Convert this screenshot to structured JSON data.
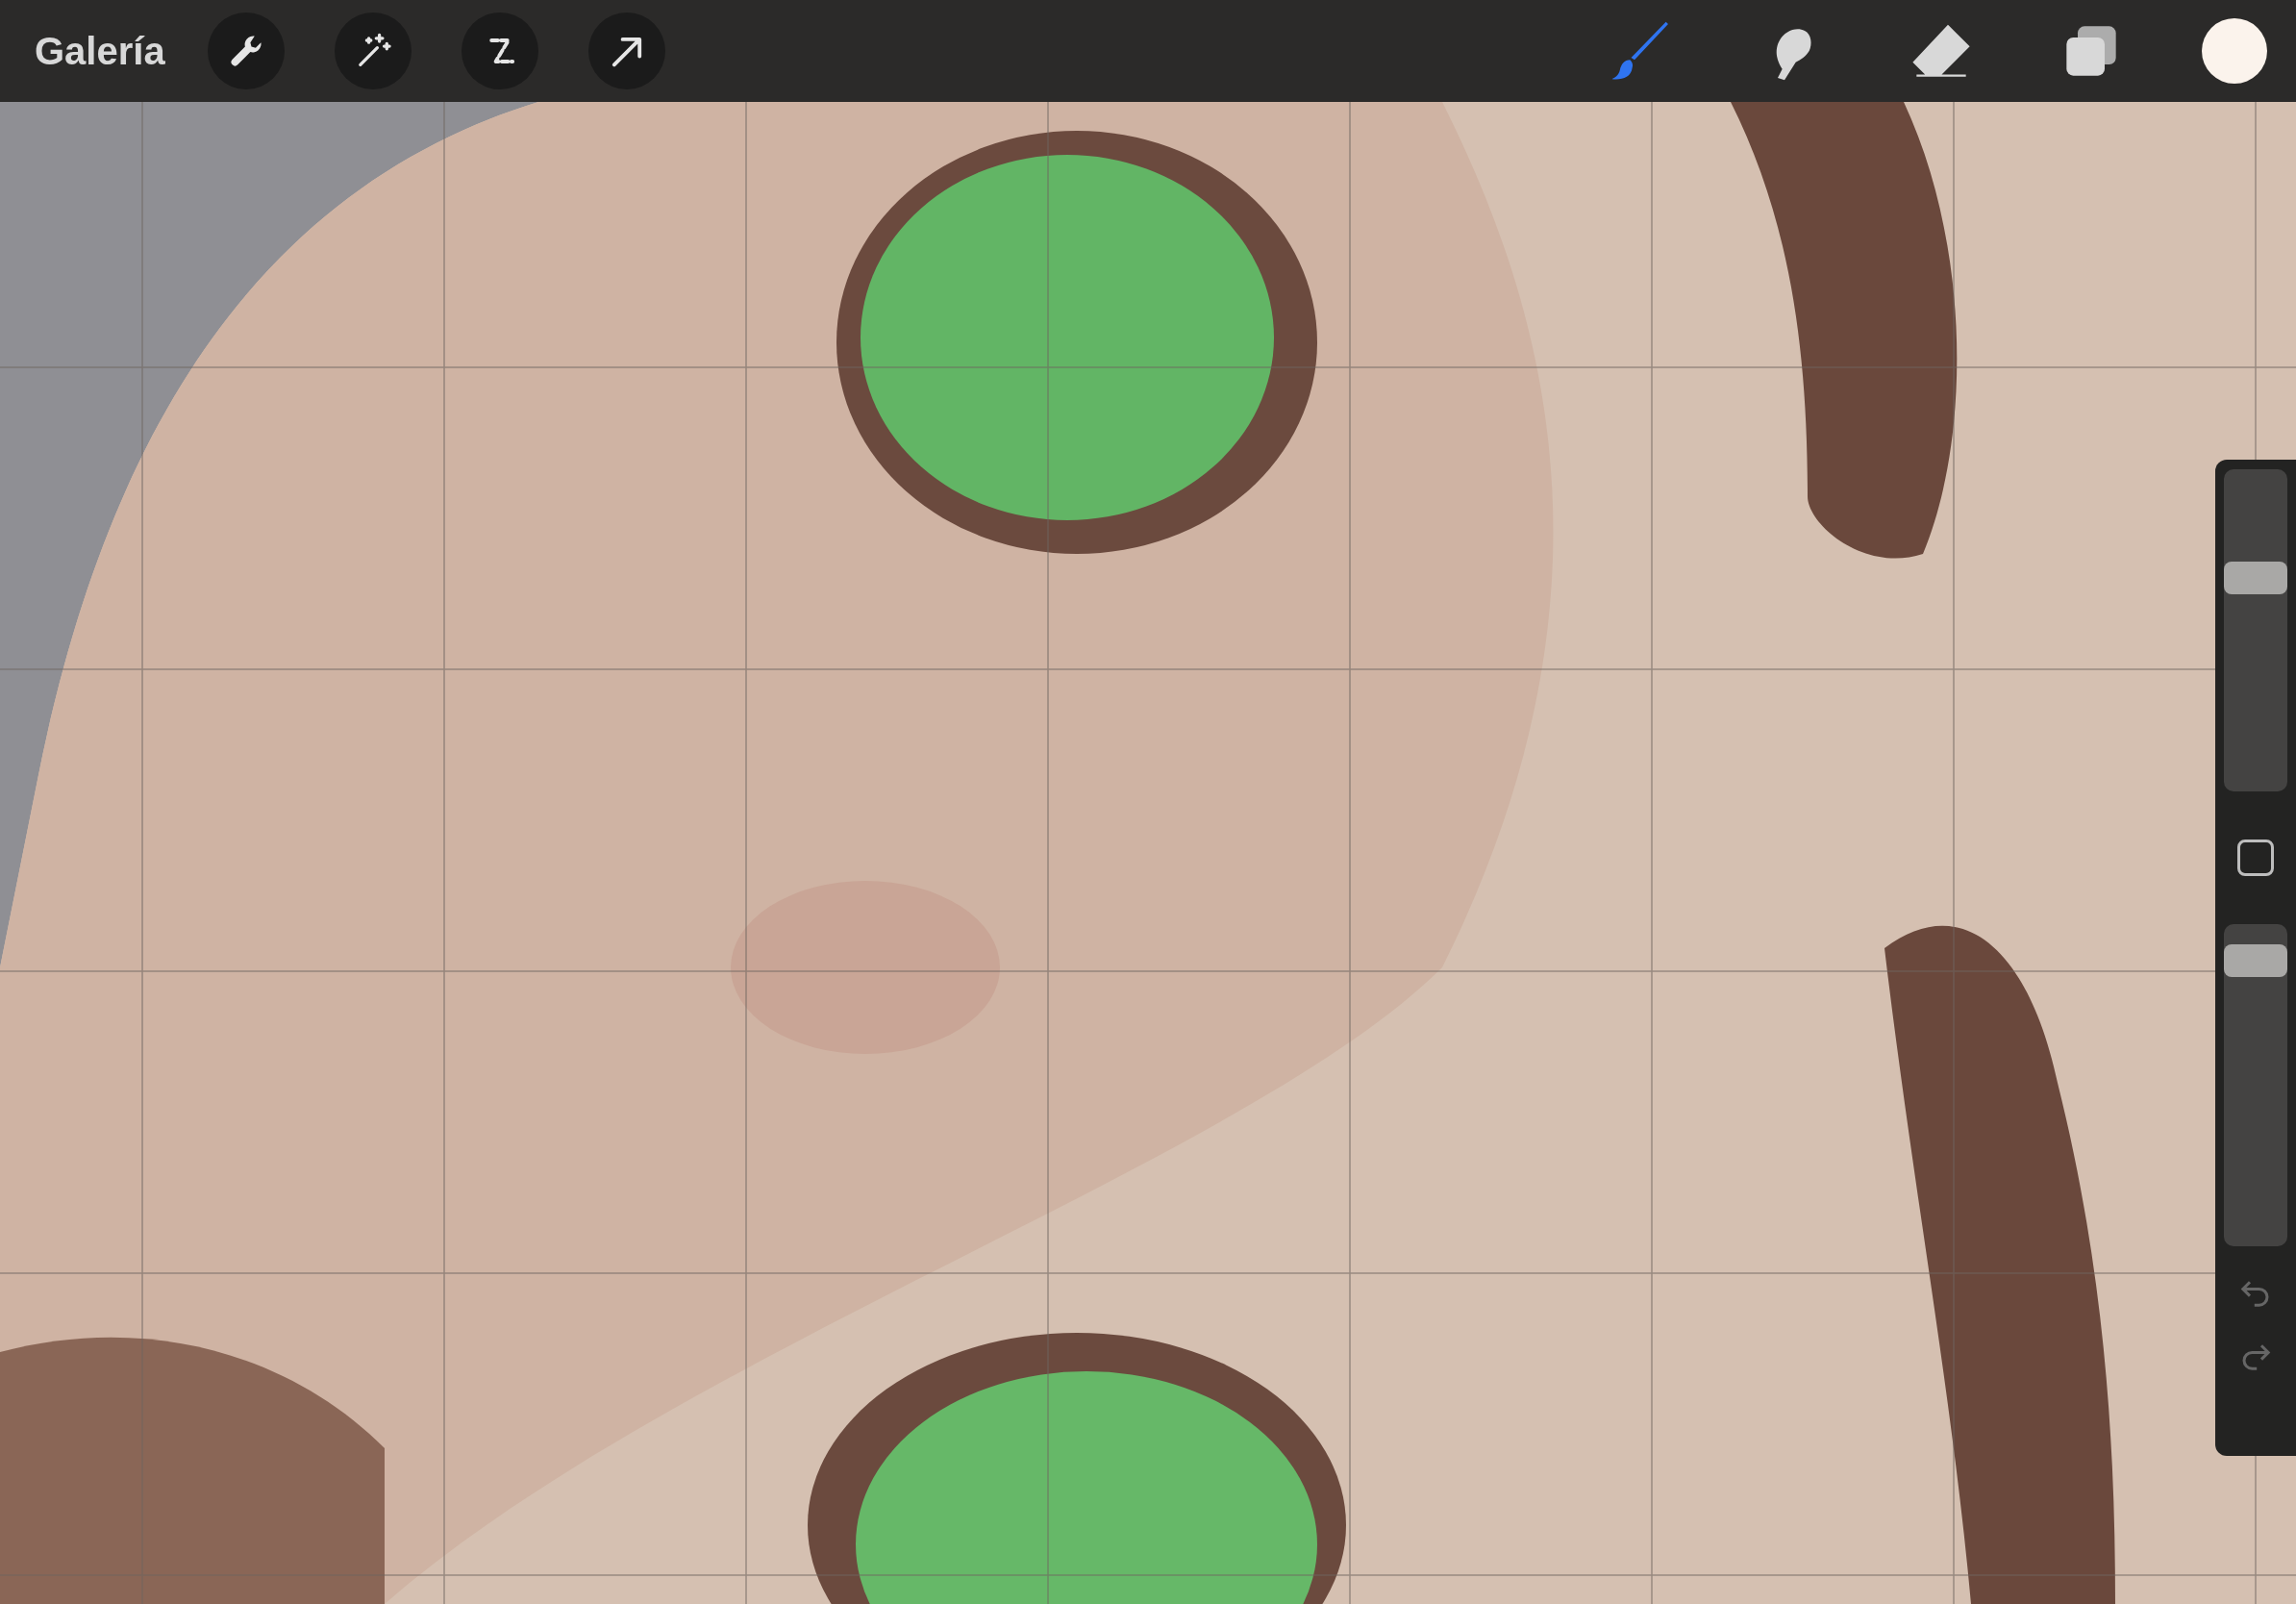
{
  "toolbar": {
    "gallery": "Galería",
    "left_tools": [
      {
        "kind": "wrench"
      },
      {
        "kind": "wand"
      },
      {
        "kind": "selection"
      },
      {
        "kind": "transform"
      }
    ],
    "right_tools": [
      {
        "kind": "brush",
        "selected": true
      },
      {
        "kind": "smudge",
        "selected": false
      },
      {
        "kind": "eraser",
        "selected": false
      },
      {
        "kind": "layers",
        "selected": false
      }
    ]
  },
  "sidebar": {
    "size_slider": {
      "level": 0.68
    },
    "opacity_slider": {
      "level": 0.93
    }
  }
}
